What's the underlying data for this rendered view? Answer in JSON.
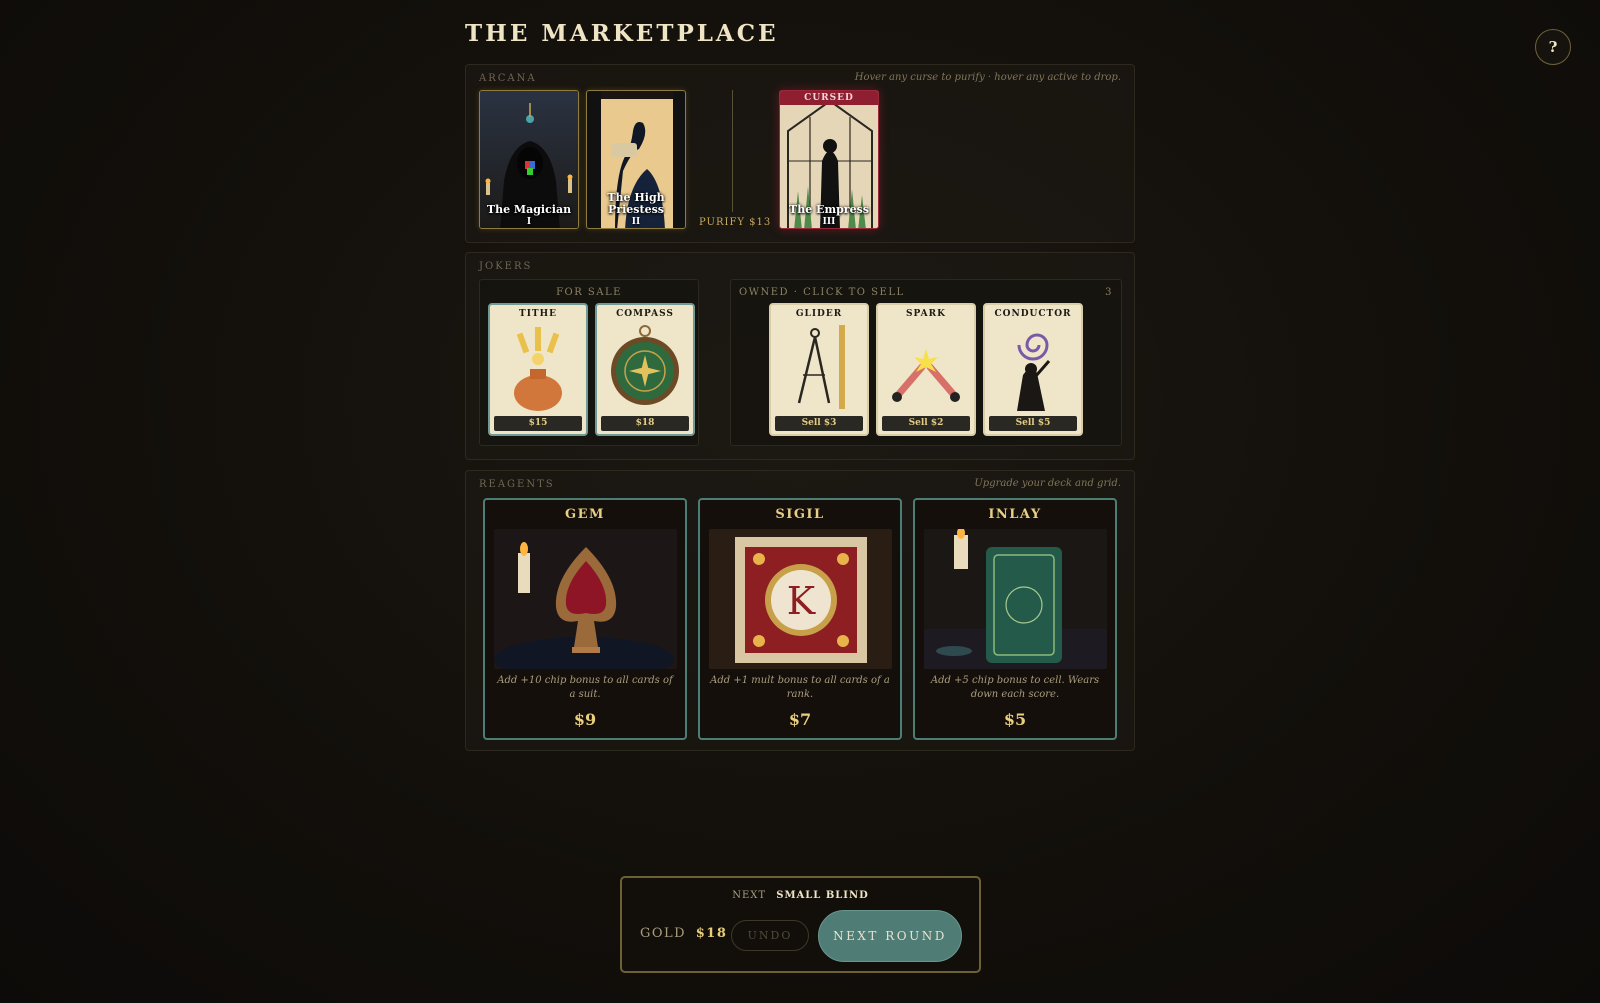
{
  "header": {
    "title": "THE MARKETPLACE",
    "help_label": "?"
  },
  "arcana": {
    "label": "ARCANA",
    "hint": "Hover any curse to purify · hover any active to drop.",
    "active": [
      {
        "name": "The Magician",
        "numeral": "I"
      },
      {
        "name": "The High Priestess",
        "numeral": "II"
      }
    ],
    "purify_label": "PURIFY $13",
    "cursed": [
      {
        "banner": "CURSED",
        "name": "The Empress",
        "numeral": "III"
      }
    ]
  },
  "jokers": {
    "label": "JOKERS",
    "for_sale_label": "FOR SALE",
    "for_sale": [
      {
        "name": "TITHE",
        "price": "$15",
        "icon": "potion-vase-icon"
      },
      {
        "name": "COMPASS",
        "price": "$18",
        "icon": "compass-icon"
      }
    ],
    "owned_label": "OWNED · CLICK TO SELL",
    "owned_count": "3",
    "owned": [
      {
        "name": "GLIDER",
        "sell": "Sell $3",
        "icon": "drafting-compass-icon"
      },
      {
        "name": "SPARK",
        "sell": "Sell $2",
        "icon": "spark-rods-icon"
      },
      {
        "name": "CONDUCTOR",
        "sell": "Sell $5",
        "icon": "conductor-figure-icon"
      }
    ]
  },
  "reagents": {
    "label": "REAGENTS",
    "hint": "Upgrade your deck and grid.",
    "items": [
      {
        "name": "GEM",
        "desc": "Add +10 chip bonus to all cards of a suit.",
        "price": "$9"
      },
      {
        "name": "SIGIL",
        "desc": "Add +1 mult bonus to all cards of a rank.",
        "price": "$7"
      },
      {
        "name": "INLAY",
        "desc": "Add +5 chip bonus to cell. Wears down each score.",
        "price": "$5"
      }
    ]
  },
  "footer": {
    "next_prefix": "NEXT",
    "next_blind": "SMALL BLIND",
    "gold_label": "GOLD",
    "gold_value": "$18",
    "undo_label": "UNDO",
    "next_round_label": "NEXT ROUND"
  },
  "colors": {
    "accent_gold": "#e9cd7a",
    "teal": "#4f7d76",
    "cursed_red": "#8f1f30",
    "background": "#120f0b"
  }
}
